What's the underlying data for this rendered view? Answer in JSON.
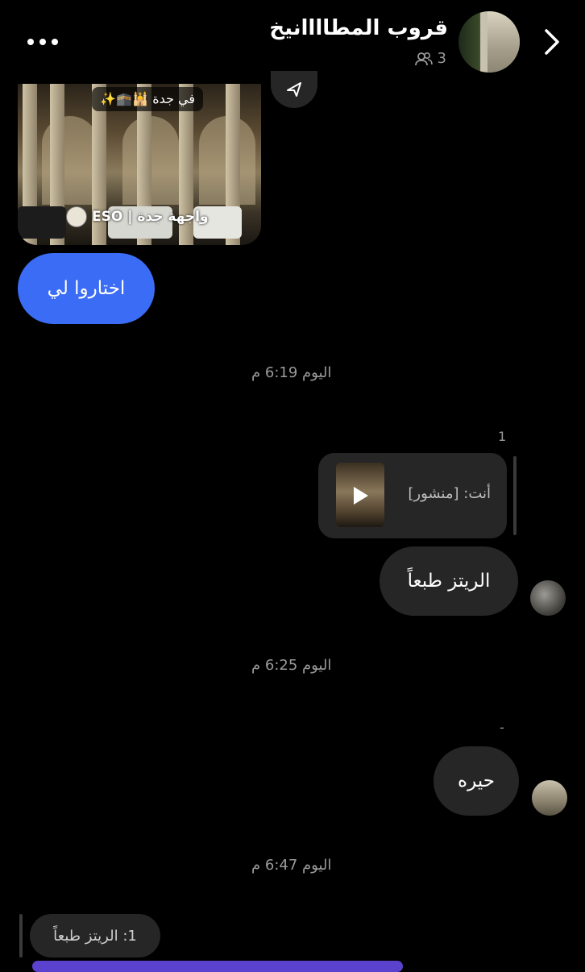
{
  "header": {
    "title": "قروب المطاااانيخ",
    "member_count": "3",
    "back_icon": "chevron-right-icon",
    "menu_icon": "more-horizontal-icon"
  },
  "shared_post": {
    "location": "في جدة 🕌🕋✨",
    "account": "واجهة جدة | ESO"
  },
  "messages": {
    "choose_for_me": "اختاروا لي",
    "time_1": "اليوم 6:19 م",
    "read_count_1": "1",
    "reply_label": "أنت: [منشور]",
    "ritz": "الريتز طبعاً",
    "time_2": "اليوم 6:25 م",
    "read_mark_2": "-",
    "confused": "حيره",
    "time_3": "اليوم 6:47 م"
  },
  "composer": {
    "replying_to": "1: الريتز طبعاً"
  },
  "colors": {
    "accent_blue": "#3b6cf5",
    "bubble_gray": "#262626",
    "muted_text": "#9a9a9a"
  }
}
